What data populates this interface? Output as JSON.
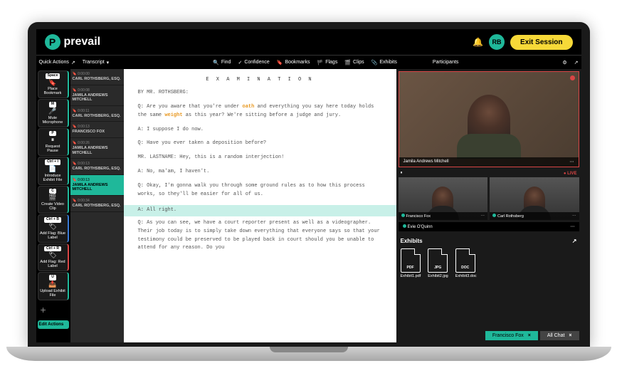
{
  "brand": "prevail",
  "header": {
    "avatar": "RB",
    "exit": "Exit Session"
  },
  "subbar": {
    "quick_actions": "Quick Actions",
    "transcript": "Transcript",
    "find": "Find",
    "confidence": "Confidence",
    "bookmarks": "Bookmarks",
    "flags": "Flags",
    "clips": "Clips",
    "exhibits": "Exhibits",
    "participants": "Participants"
  },
  "qa": [
    {
      "key": "Space",
      "icon": "🔖",
      "label": "Place Bookmark",
      "accent": "teal"
    },
    {
      "key": "M",
      "icon": "🎤",
      "label": "Mute Microphone",
      "accent": "teal"
    },
    {
      "key": "P",
      "icon": "⏸",
      "label": "Request Pause",
      "accent": "teal"
    },
    {
      "key": "Ctrl + I",
      "icon": "📄",
      "label": "Introduce Exhibit File",
      "accent": "teal"
    },
    {
      "key": "C",
      "icon": "🎬",
      "label": "Create Video Clip",
      "accent": "teal"
    },
    {
      "key": "Ctrl + B",
      "icon": "🏷",
      "label": "Add Flag: Blue Label",
      "accent": "blue"
    },
    {
      "key": "Ctrl + R",
      "icon": "🏷",
      "label": "Add Flag: Red Label",
      "accent": "red"
    },
    {
      "key": "U",
      "icon": "📤",
      "label": "Upload Exhibit File",
      "accent": "teal"
    }
  ],
  "edit_actions": "Edit Actions",
  "speakers": [
    {
      "ts": "0:00:00",
      "name": "CARL ROTHSBERG, ESQ.",
      "flag": ""
    },
    {
      "ts": "0:00:08",
      "name": "JAMILA ANDREWS MITCHELL",
      "flag": "red"
    },
    {
      "ts": "0:00:11",
      "name": "CARL ROTHSBERG, ESQ.",
      "flag": ""
    },
    {
      "ts": "0:00:13",
      "name": "FRANCISCO FOX",
      "flag": ""
    },
    {
      "ts": "0:00:26",
      "name": "JAMILA ANDREWS MITCHELL",
      "flag": ""
    },
    {
      "ts": "0:00:13",
      "name": "CARL ROTHSBERG, ESQ.",
      "flag": ""
    },
    {
      "ts": "0:00:13",
      "name": "JAMILA ANDREWS MITCHELL",
      "flag": "red",
      "sel": true
    },
    {
      "ts": "0:00:34",
      "name": "CARL ROTHSBERG, ESQ.",
      "flag": ""
    }
  ],
  "transcript": {
    "heading": "E X A M I N A T I O N",
    "by": "BY MR. ROTHSBERG:",
    "q1a": "Q:  Are you aware that you're under ",
    "q1_oath": "oath",
    "q1b": " and everything you say here today holds the same ",
    "q1_weight": "weight",
    "q1c": " as this year? We're sitting before a judge and jury.",
    "a1": "A:  I suppose I do now.",
    "q2": "Q:  Have you ever taken a deposition before?",
    "int": "MR. LASTNAME: Hey, this is a random interjection!",
    "a2": "A:  No, ma'am, I haven't.",
    "q3": "Q:  Okay, I'm gonna walk you through some ground rules as to how  this process works, so they'll be easier for all of us.",
    "a3": "A:  All right.",
    "q4": "Q:  As you can see, we have a court reporter present as well as a videographer. Their job today is to simply take down everything that everyone says so that your testimony could be preserved to be  played back in court should you be unable to attend for any reason. Do you"
  },
  "video": {
    "main": "Jamila Andrews Mitchell",
    "live": "● LIVE",
    "p1": "Francisco Fox",
    "p2": "Carl Rothsberg",
    "p3": "Evie O'Quinn"
  },
  "exhibits": {
    "title": "Exhibits",
    "items": [
      {
        "type": "PDF",
        "name": "Exhibit1.pdf"
      },
      {
        "type": "JPG",
        "name": "Exhibit2.jpg"
      },
      {
        "type": "DOC",
        "name": "Exhibit3.doc"
      }
    ]
  },
  "chat": {
    "tab1": "Francisco Fox",
    "tab2": "All Chat"
  }
}
